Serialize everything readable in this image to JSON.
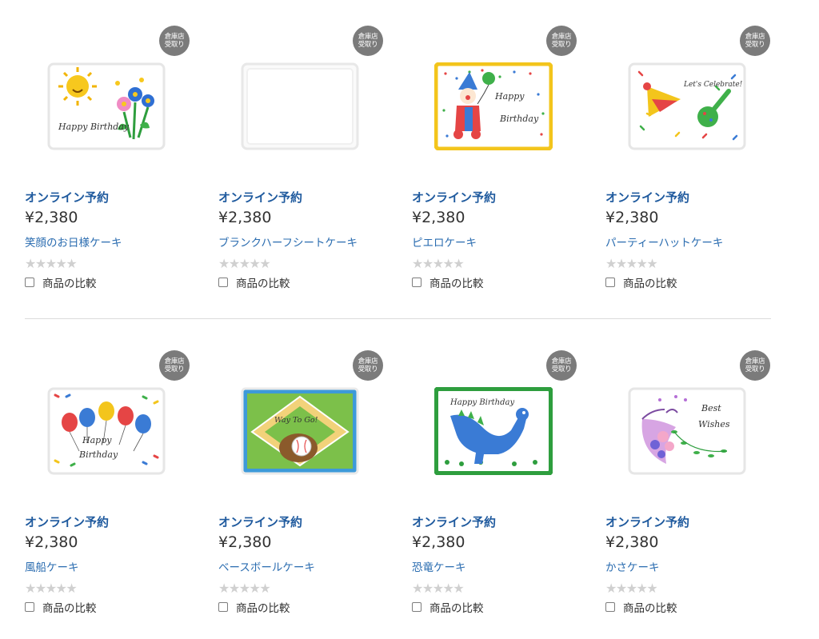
{
  "products": [
    {
      "tag": "オンライン予約",
      "price": "¥2,380",
      "name": "笑顔のお日様ケーキ",
      "badge": [
        "倉庫店",
        "受取り"
      ],
      "compare_label": "商品の比較",
      "rating": "★★★★★",
      "image": "sun-flower-birthday-cake-image",
      "image_text": "Happy Birthday"
    },
    {
      "tag": "オンライン予約",
      "price": "¥2,380",
      "name": "ブランクハーフシートケーキ",
      "badge": [
        "倉庫店",
        "受取り"
      ],
      "compare_label": "商品の比較",
      "rating": "★★★★★",
      "image": "blank-half-sheet-cake-image",
      "image_text": ""
    },
    {
      "tag": "オンライン予約",
      "price": "¥2,380",
      "name": "ピエロケーキ",
      "badge": [
        "倉庫店",
        "受取り"
      ],
      "compare_label": "商品の比較",
      "rating": "★★★★★",
      "image": "clown-cake-image",
      "image_text": "Happy Birthday"
    },
    {
      "tag": "オンライン予約",
      "price": "¥2,380",
      "name": "パーティーハットケーキ",
      "badge": [
        "倉庫店",
        "受取り"
      ],
      "compare_label": "商品の比較",
      "rating": "★★★★★",
      "image": "party-hat-cake-image",
      "image_text": "Let's Celebrate!"
    },
    {
      "tag": "オンライン予約",
      "price": "¥2,380",
      "name": "風船ケーキ",
      "badge": [
        "倉庫店",
        "受取り"
      ],
      "compare_label": "商品の比較",
      "rating": "★★★★★",
      "image": "balloon-cake-image",
      "image_text": "Happy Birthday"
    },
    {
      "tag": "オンライン予約",
      "price": "¥2,380",
      "name": "ベースボールケーキ",
      "badge": [
        "倉庫店",
        "受取り"
      ],
      "compare_label": "商品の比較",
      "rating": "★★★★★",
      "image": "baseball-cake-image",
      "image_text": "Way To Go!"
    },
    {
      "tag": "オンライン予約",
      "price": "¥2,380",
      "name": "恐竜ケーキ",
      "badge": [
        "倉庫店",
        "受取り"
      ],
      "compare_label": "商品の比較",
      "rating": "★★★★★",
      "image": "dinosaur-cake-image",
      "image_text": "Happy Birthday"
    },
    {
      "tag": "オンライン予約",
      "price": "¥2,380",
      "name": "かさケーキ",
      "badge": [
        "倉庫店",
        "受取り"
      ],
      "compare_label": "商品の比較",
      "rating": "★★★★★",
      "image": "umbrella-cake-image",
      "image_text": "Best Wishes"
    }
  ],
  "colors": {
    "tag": "#1f5a9e",
    "link": "#2a6cb0",
    "badge": "#7b7b7b",
    "star_empty": "#d0d0d0"
  }
}
